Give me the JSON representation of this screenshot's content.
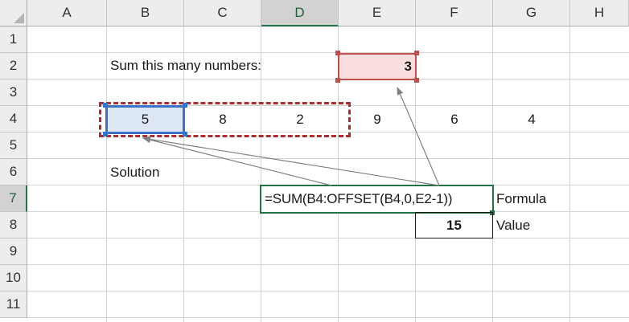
{
  "columns": [
    "A",
    "B",
    "C",
    "D",
    "E",
    "F",
    "G",
    "H"
  ],
  "rows": [
    "1",
    "2",
    "3",
    "4",
    "5",
    "6",
    "7",
    "8",
    "9",
    "10",
    "11"
  ],
  "active_column": "D",
  "active_row": "7",
  "cells": {
    "B2": "Sum this many numbers:",
    "E2": "3",
    "B4": "5",
    "C4": "8",
    "D4": "2",
    "E4": "9",
    "F4": "6",
    "G4": "4",
    "B6": "Solution",
    "D7": "=SUM(B4:OFFSET(B4,0,E2-1))",
    "G7": "Formula",
    "F8": "15",
    "G8": "Value"
  },
  "colors": {
    "header_bg": "#ededed",
    "active_accent": "#217346",
    "input_highlight_fill": "#f8dede",
    "input_highlight_border": "#c0504d",
    "range_dash": "#b02c2c",
    "start_cell_fill": "#dce6f4",
    "start_cell_border": "#3a74c8",
    "arrow": "#808080"
  }
}
